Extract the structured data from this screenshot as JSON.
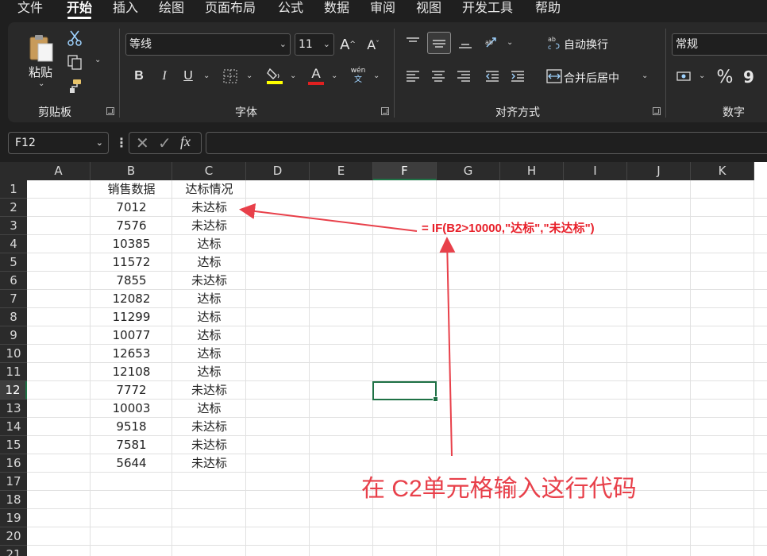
{
  "menu": {
    "tabs": [
      "文件",
      "开始",
      "插入",
      "绘图",
      "页面布局",
      "公式",
      "数据",
      "审阅",
      "视图",
      "开发工具",
      "帮助"
    ],
    "active": "开始"
  },
  "ribbon": {
    "clipboard": {
      "paste_label": "粘贴",
      "group_label": "剪贴板"
    },
    "font": {
      "font_name": "等线",
      "font_size": "11",
      "group_label": "字体",
      "bold": "B",
      "italic": "I",
      "underline": "U",
      "font_color_letter": "A",
      "grow": "A",
      "shrink": "A",
      "pinyin_top": "wén",
      "pinyin_bottom": "文"
    },
    "alignment": {
      "wrap_text": "自动换行",
      "merge_center": "合并后居中",
      "group_label": "对齐方式"
    },
    "number": {
      "format": "常规",
      "group_label": "数字",
      "percent": "%",
      "comma": "9"
    },
    "colors": {
      "highlight": "#ffff00",
      "font_color": "#e02020",
      "accent": "#1e7145"
    }
  },
  "formula_bar": {
    "name_box": "F12",
    "fx_label": "fx",
    "formula": ""
  },
  "sheet": {
    "columns": [
      "A",
      "B",
      "C",
      "D",
      "E",
      "F",
      "G",
      "H",
      "I",
      "J",
      "K"
    ],
    "rows": [
      "1",
      "2",
      "3",
      "4",
      "5",
      "6",
      "7",
      "8",
      "9",
      "10",
      "11",
      "12",
      "13",
      "14",
      "15",
      "16",
      "17",
      "18",
      "19",
      "20",
      "21"
    ],
    "selected_column": "F",
    "selected_row": "12",
    "headers": {
      "b": "销售数据",
      "c": "达标情况"
    },
    "data": [
      {
        "b": "7012",
        "c": "未达标"
      },
      {
        "b": "7576",
        "c": "未达标"
      },
      {
        "b": "10385",
        "c": "达标"
      },
      {
        "b": "11572",
        "c": "达标"
      },
      {
        "b": "7855",
        "c": "未达标"
      },
      {
        "b": "12082",
        "c": "达标"
      },
      {
        "b": "11299",
        "c": "达标"
      },
      {
        "b": "10077",
        "c": "达标"
      },
      {
        "b": "12653",
        "c": "达标"
      },
      {
        "b": "12108",
        "c": "达标"
      },
      {
        "b": "7772",
        "c": "未达标"
      },
      {
        "b": "10003",
        "c": "达标"
      },
      {
        "b": "9518",
        "c": "未达标"
      },
      {
        "b": "7581",
        "c": "未达标"
      },
      {
        "b": "5644",
        "c": "未达标"
      }
    ]
  },
  "annotations": {
    "formula_text": "= IF(B2>10000,\"达标\",\"未达标\")",
    "instruction_text": "在 C2单元格输入这行代码",
    "color": "#e8202a"
  }
}
